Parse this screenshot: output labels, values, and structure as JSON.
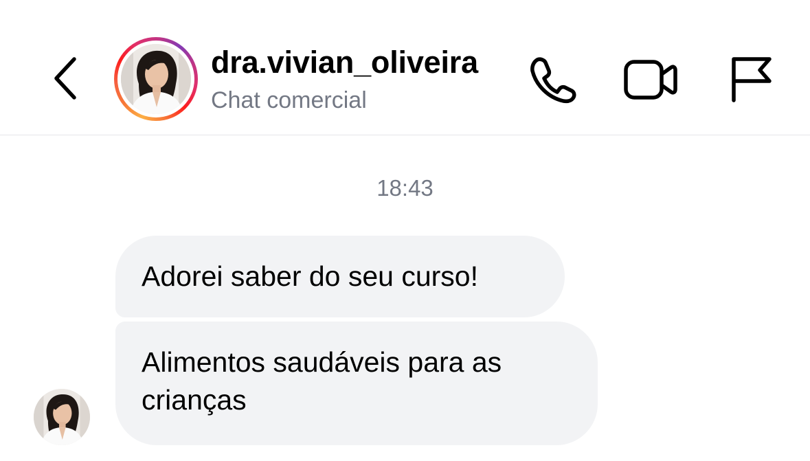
{
  "header": {
    "username": "dra.vivian_oliveira",
    "subtitle": "Chat comercial",
    "icons": {
      "back": "chevron-left-icon",
      "call": "phone-icon",
      "video": "video-camera-icon",
      "report": "flag-icon"
    },
    "story_ring_colors": [
      "#fcaf45",
      "#f77737",
      "#fd1d1d",
      "#e1306c",
      "#c13584",
      "#833ab4"
    ]
  },
  "thread": {
    "timestamp": "18:43",
    "messages": [
      {
        "text": "Adorei saber do seu curso!"
      },
      {
        "text": "Alimentos saudáveis para as crianças"
      }
    ]
  },
  "colors": {
    "bubble_bg": "#f2f3f5",
    "secondary_text": "#737884",
    "divider": "#e6e6e9"
  }
}
